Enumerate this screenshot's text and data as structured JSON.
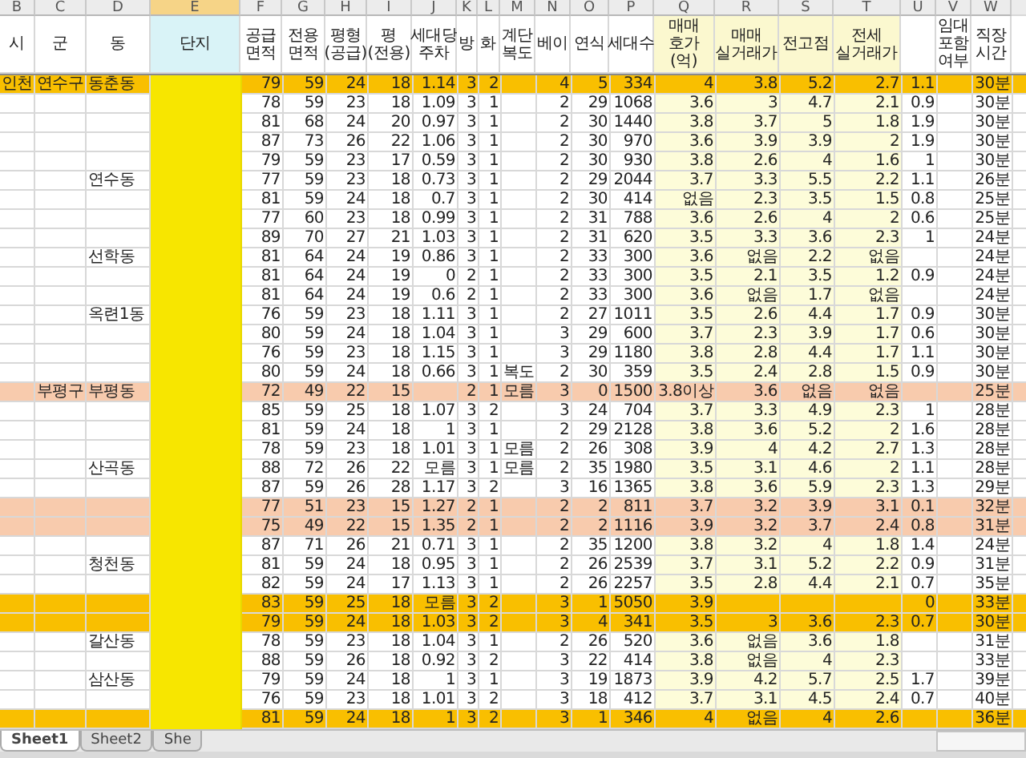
{
  "column_letters": [
    {
      "label": "B",
      "selected": false
    },
    {
      "label": "C",
      "selected": false
    },
    {
      "label": "D",
      "selected": false
    },
    {
      "label": "E",
      "selected": true
    },
    {
      "label": "F",
      "selected": false
    },
    {
      "label": "G",
      "selected": false
    },
    {
      "label": "H",
      "selected": false
    },
    {
      "label": "I",
      "selected": false
    },
    {
      "label": "J",
      "selected": false
    },
    {
      "label": "K",
      "selected": false
    },
    {
      "label": "L",
      "selected": false
    },
    {
      "label": "M",
      "selected": false
    },
    {
      "label": "N",
      "selected": false
    },
    {
      "label": "O",
      "selected": false
    },
    {
      "label": "P",
      "selected": false
    },
    {
      "label": "Q",
      "selected": false
    },
    {
      "label": "R",
      "selected": false
    },
    {
      "label": "S",
      "selected": false
    },
    {
      "label": "T",
      "selected": false
    },
    {
      "label": "U",
      "selected": false
    },
    {
      "label": "V",
      "selected": false
    },
    {
      "label": "W",
      "selected": false
    }
  ],
  "header": {
    "B": "시",
    "C": "군",
    "D": "동",
    "E": "단지",
    "F": "공급 면적",
    "G": "전용 면적",
    "H": "평형 (공급)",
    "I": "평 (전용)",
    "J": "세대당 주차",
    "K": "방",
    "L": "화",
    "M": "계단 복도",
    "N": "베이",
    "O": "연식",
    "P": "세대수",
    "Q": "매매 호가(억)",
    "R": "매매 실거래가",
    "S": "전고점",
    "T": "전세 실거래가",
    "V": "임대 포함 여부",
    "W": "직장 시간"
  },
  "rows": [
    {
      "color": "#f9bf00",
      "cells": {
        "B": "인천",
        "C": "연수구",
        "D": "동춘동",
        "F": "79",
        "G": "59",
        "H": "24",
        "I": "18",
        "J": "1.14",
        "K": "3",
        "L": "2",
        "N": "4",
        "O": "5",
        "P": "334",
        "Q": "4",
        "R": "3.8",
        "S": "5.2",
        "T": "2.7",
        "U": "1.1",
        "W": "30분"
      }
    },
    {
      "cells": {
        "F": "78",
        "G": "59",
        "H": "23",
        "I": "18",
        "J": "1.09",
        "K": "3",
        "L": "1",
        "N": "2",
        "O": "29",
        "P": "1068",
        "Q": "3.6",
        "R": "3",
        "S": "4.7",
        "T": "2.1",
        "U": "0.9",
        "W": "30분"
      }
    },
    {
      "cells": {
        "F": "81",
        "G": "68",
        "H": "24",
        "I": "20",
        "J": "0.97",
        "K": "3",
        "L": "1",
        "N": "2",
        "O": "30",
        "P": "1440",
        "Q": "3.8",
        "R": "3.7",
        "S": "5",
        "T": "1.8",
        "U": "1.9",
        "W": "30분"
      }
    },
    {
      "cells": {
        "F": "87",
        "G": "73",
        "H": "26",
        "I": "22",
        "J": "1.06",
        "K": "3",
        "L": "1",
        "N": "2",
        "O": "30",
        "P": "970",
        "Q": "3.6",
        "R": "3.9",
        "S": "3.9",
        "T": "2",
        "U": "1.9",
        "W": "30분"
      }
    },
    {
      "cells": {
        "F": "79",
        "G": "59",
        "H": "23",
        "I": "17",
        "J": "0.59",
        "K": "3",
        "L": "1",
        "N": "2",
        "O": "30",
        "P": "930",
        "Q": "3.8",
        "R": "2.6",
        "S": "4",
        "T": "1.6",
        "U": "1",
        "W": "30분"
      }
    },
    {
      "cells": {
        "D": "연수동",
        "F": "77",
        "G": "59",
        "H": "23",
        "I": "18",
        "J": "0.73",
        "K": "3",
        "L": "1",
        "N": "2",
        "O": "29",
        "P": "2044",
        "Q": "3.7",
        "R": "3.3",
        "S": "5.5",
        "T": "2.2",
        "U": "1.1",
        "W": "26분"
      }
    },
    {
      "cells": {
        "F": "81",
        "G": "59",
        "H": "24",
        "I": "18",
        "J": "0.7",
        "K": "3",
        "L": "1",
        "N": "2",
        "O": "30",
        "P": "414",
        "Q": "없음",
        "R": "2.3",
        "S": "3.5",
        "T": "1.5",
        "U": "0.8",
        "W": "25분"
      }
    },
    {
      "cells": {
        "F": "77",
        "G": "60",
        "H": "23",
        "I": "18",
        "J": "0.99",
        "K": "3",
        "L": "1",
        "N": "2",
        "O": "31",
        "P": "788",
        "Q": "3.6",
        "R": "2.6",
        "S": "4",
        "T": "2",
        "U": "0.6",
        "W": "25분"
      }
    },
    {
      "cells": {
        "F": "89",
        "G": "70",
        "H": "27",
        "I": "21",
        "J": "1.03",
        "K": "3",
        "L": "1",
        "N": "2",
        "O": "31",
        "P": "620",
        "Q": "3.5",
        "R": "3.3",
        "S": "3.6",
        "T": "2.3",
        "U": "1",
        "W": "24분"
      }
    },
    {
      "cells": {
        "D": "선학동",
        "F": "81",
        "G": "64",
        "H": "24",
        "I": "19",
        "J": "0.86",
        "K": "3",
        "L": "1",
        "N": "2",
        "O": "33",
        "P": "300",
        "Q": "3.6",
        "R": "없음",
        "S": "2.2",
        "T": "없음",
        "W": "24분"
      }
    },
    {
      "cells": {
        "F": "81",
        "G": "64",
        "H": "24",
        "I": "19",
        "J": "0",
        "K": "2",
        "L": "1",
        "N": "2",
        "O": "33",
        "P": "300",
        "Q": "3.5",
        "R": "2.1",
        "S": "3.5",
        "T": "1.2",
        "U": "0.9",
        "W": "24분"
      }
    },
    {
      "cells": {
        "F": "81",
        "G": "64",
        "H": "24",
        "I": "19",
        "J": "0.6",
        "K": "2",
        "L": "1",
        "N": "2",
        "O": "33",
        "P": "300",
        "Q": "3.6",
        "R": "없음",
        "S": "1.7",
        "T": "없음",
        "W": "24분"
      }
    },
    {
      "cells": {
        "D": "옥련1동",
        "F": "76",
        "G": "59",
        "H": "23",
        "I": "18",
        "J": "1.11",
        "K": "3",
        "L": "1",
        "N": "2",
        "O": "27",
        "P": "1011",
        "Q": "3.5",
        "R": "2.6",
        "S": "4.4",
        "T": "1.7",
        "U": "0.9",
        "W": "30분"
      }
    },
    {
      "cells": {
        "F": "80",
        "G": "59",
        "H": "24",
        "I": "18",
        "J": "1.04",
        "K": "3",
        "L": "1",
        "N": "3",
        "O": "29",
        "P": "600",
        "Q": "3.7",
        "R": "2.3",
        "S": "3.9",
        "T": "1.7",
        "U": "0.6",
        "W": "30분"
      }
    },
    {
      "cells": {
        "F": "76",
        "G": "59",
        "H": "23",
        "I": "18",
        "J": "1.15",
        "K": "3",
        "L": "1",
        "N": "3",
        "O": "29",
        "P": "1180",
        "Q": "3.8",
        "R": "2.8",
        "S": "4.4",
        "T": "1.7",
        "U": "1.1",
        "W": "30분"
      }
    },
    {
      "cells": {
        "F": "80",
        "G": "59",
        "H": "24",
        "I": "18",
        "J": "0.66",
        "K": "3",
        "L": "1",
        "M": "복도",
        "N": "2",
        "O": "30",
        "P": "359",
        "Q": "3.5",
        "R": "2.4",
        "S": "2.8",
        "T": "1.5",
        "U": "0.9",
        "W": "30분"
      }
    },
    {
      "color": "#f8cbad",
      "cells": {
        "C": "부평구",
        "D": "부평동",
        "F": "72",
        "G": "49",
        "H": "22",
        "I": "15",
        "K": "2",
        "L": "1",
        "M": "모름",
        "N": "3",
        "O": "0",
        "P": "1500",
        "Q": "3.8이상",
        "R": "3.6",
        "S": "없음",
        "T": "없음",
        "W": "25분"
      }
    },
    {
      "cells": {
        "F": "85",
        "G": "59",
        "H": "25",
        "I": "18",
        "J": "1.07",
        "K": "3",
        "L": "2",
        "N": "3",
        "O": "24",
        "P": "704",
        "Q": "3.7",
        "R": "3.3",
        "S": "4.9",
        "T": "2.3",
        "U": "1",
        "W": "28분"
      }
    },
    {
      "cells": {
        "F": "81",
        "G": "59",
        "H": "24",
        "I": "18",
        "J": "1",
        "K": "3",
        "L": "1",
        "N": "2",
        "O": "29",
        "P": "2128",
        "Q": "3.8",
        "R": "3.6",
        "S": "5.2",
        "T": "2",
        "U": "1.6",
        "W": "28분"
      }
    },
    {
      "cells": {
        "F": "78",
        "G": "59",
        "H": "23",
        "I": "18",
        "J": "1.01",
        "K": "3",
        "L": "1",
        "M": "모름",
        "N": "2",
        "O": "26",
        "P": "308",
        "Q": "3.9",
        "R": "4",
        "S": "4.2",
        "T": "2.7",
        "U": "1.3",
        "W": "28분"
      }
    },
    {
      "cells": {
        "D": "산곡동",
        "F": "88",
        "G": "72",
        "H": "26",
        "I": "22",
        "J": "모름",
        "K": "3",
        "L": "1",
        "M": "모름",
        "N": "2",
        "O": "35",
        "P": "1980",
        "Q": "3.5",
        "R": "3.1",
        "S": "4.6",
        "T": "2",
        "U": "1.1",
        "W": "28분"
      }
    },
    {
      "cells": {
        "F": "87",
        "G": "59",
        "H": "26",
        "I": "28",
        "J": "1.17",
        "K": "3",
        "L": "2",
        "N": "3",
        "O": "16",
        "P": "1365",
        "Q": "3.8",
        "R": "3.6",
        "S": "5.9",
        "T": "2.3",
        "U": "1.3",
        "W": "29분"
      }
    },
    {
      "color": "#f8cbad",
      "cells": {
        "F": "77",
        "G": "51",
        "H": "23",
        "I": "15",
        "J": "1.27",
        "K": "2",
        "L": "1",
        "N": "2",
        "O": "2",
        "P": "811",
        "Q": "3.7",
        "R": "3.2",
        "S": "3.9",
        "T": "3.1",
        "U": "0.1",
        "W": "32분"
      }
    },
    {
      "color": "#f8cbad",
      "cells": {
        "F": "75",
        "G": "49",
        "H": "22",
        "I": "15",
        "J": "1.35",
        "K": "2",
        "L": "1",
        "N": "2",
        "O": "2",
        "P": "1116",
        "Q": "3.9",
        "R": "3.2",
        "S": "3.7",
        "T": "2.4",
        "U": "0.8",
        "W": "31분"
      }
    },
    {
      "cells": {
        "F": "87",
        "G": "71",
        "H": "26",
        "I": "21",
        "J": "0.71",
        "K": "3",
        "L": "1",
        "N": "2",
        "O": "35",
        "P": "1200",
        "Q": "3.8",
        "R": "3.2",
        "S": "4",
        "T": "1.8",
        "U": "1.4",
        "W": "24분"
      }
    },
    {
      "cells": {
        "D": "청천동",
        "F": "81",
        "G": "59",
        "H": "24",
        "I": "18",
        "J": "0.95",
        "K": "3",
        "L": "1",
        "N": "2",
        "O": "26",
        "P": "2539",
        "Q": "3.7",
        "R": "3.1",
        "S": "5.2",
        "T": "2.2",
        "U": "0.9",
        "W": "31분"
      }
    },
    {
      "cells": {
        "F": "82",
        "G": "59",
        "H": "24",
        "I": "17",
        "J": "1.13",
        "K": "3",
        "L": "1",
        "N": "2",
        "O": "26",
        "P": "2257",
        "Q": "3.5",
        "R": "2.8",
        "S": "4.4",
        "T": "2.1",
        "U": "0.7",
        "W": "35분"
      }
    },
    {
      "color": "#f9bf00",
      "cells": {
        "F": "83",
        "G": "59",
        "H": "25",
        "I": "18",
        "J": "모름",
        "K": "3",
        "L": "2",
        "N": "3",
        "O": "1",
        "P": "5050",
        "Q": "3.9",
        "U": "0",
        "W": "33분"
      }
    },
    {
      "color": "#f9bf00",
      "cells": {
        "F": "79",
        "G": "59",
        "H": "24",
        "I": "18",
        "J": "1.03",
        "K": "3",
        "L": "2",
        "N": "3",
        "O": "4",
        "P": "341",
        "Q": "3.5",
        "R": "3",
        "S": "3.6",
        "T": "2.3",
        "U": "0.7",
        "W": "30분"
      }
    },
    {
      "cells": {
        "D": "갈산동",
        "F": "78",
        "G": "59",
        "H": "23",
        "I": "18",
        "J": "1.04",
        "K": "3",
        "L": "1",
        "N": "2",
        "O": "26",
        "P": "520",
        "Q": "3.6",
        "R": "없음",
        "S": "3.6",
        "T": "1.8",
        "W": "31분"
      }
    },
    {
      "cells": {
        "F": "88",
        "G": "59",
        "H": "26",
        "I": "18",
        "J": "0.92",
        "K": "3",
        "L": "2",
        "N": "3",
        "O": "22",
        "P": "414",
        "Q": "3.8",
        "R": "없음",
        "S": "4",
        "T": "2.3",
        "W": "33분"
      }
    },
    {
      "cells": {
        "D": "삼산동",
        "F": "79",
        "G": "59",
        "H": "24",
        "I": "18",
        "J": "1",
        "K": "3",
        "L": "1",
        "N": "3",
        "O": "19",
        "P": "1873",
        "Q": "3.9",
        "R": "4.2",
        "S": "5.7",
        "T": "2.5",
        "U": "1.7",
        "W": "39분"
      }
    },
    {
      "cells": {
        "F": "76",
        "G": "59",
        "H": "23",
        "I": "18",
        "J": "1.01",
        "K": "3",
        "L": "2",
        "N": "3",
        "O": "18",
        "P": "412",
        "Q": "3.7",
        "R": "3.1",
        "S": "4.5",
        "T": "2.4",
        "U": "0.7",
        "W": "40분"
      }
    },
    {
      "color": "#f9bf00",
      "cells": {
        "F": "81",
        "G": "59",
        "H": "24",
        "I": "18",
        "J": "1",
        "K": "3",
        "L": "2",
        "N": "3",
        "O": "1",
        "P": "346",
        "Q": "4",
        "R": "없음",
        "S": "4",
        "T": "2.6",
        "W": "36분"
      }
    }
  ],
  "sheet_tabs": [
    {
      "label": "Sheet1",
      "selected": true
    },
    {
      "label": "Sheet2",
      "selected": false
    },
    {
      "label": "She",
      "selected": false
    }
  ]
}
